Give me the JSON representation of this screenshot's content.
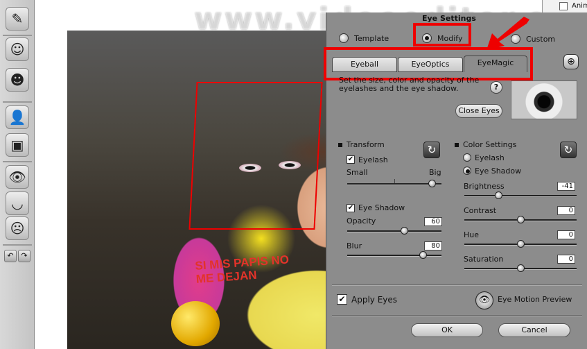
{
  "topright_label": "Anim",
  "watermark": "www.videoeditor.org",
  "toolbar": {
    "icons": [
      "paint-brush-icon",
      "face-select-icon",
      "face-adjust-icon",
      "portrait-edit-icon",
      "portrait-icon",
      "eye-icon",
      "mouth-icon",
      "head-icon"
    ],
    "undo": "↶",
    "redo": "↷"
  },
  "panel": {
    "title": "Eye Settings",
    "mode_radios": [
      {
        "label": "Template"
      },
      {
        "label": "Modify"
      },
      {
        "label": "Custom"
      }
    ],
    "tabs": [
      "Eyeball",
      "EyeOptics",
      "EyeMagic"
    ],
    "description": "Set the size, color and opacity of the eyelashes and the eye shadow.",
    "close_eyes": "Close Eyes",
    "help": "?",
    "transform": {
      "title": "Transform",
      "eyelash": "Eyelash",
      "small": "Small",
      "big": "Big",
      "eyeshadow": "Eye Shadow",
      "opacity": "Opacity",
      "opacity_val": "60",
      "blur": "Blur",
      "blur_val": "80",
      "size_level": 0.9
    },
    "color": {
      "title": "Color Settings",
      "eyelash": "Eyelash",
      "eyeshadow": "Eye Shadow",
      "brightness": "Brightness",
      "brightness_val": "-41",
      "contrast": "Contrast",
      "contrast_val": "0",
      "hue": "Hue",
      "hue_val": "0",
      "saturation": "Saturation",
      "saturation_val": "0"
    },
    "apply_eyes": "Apply Eyes",
    "eye_motion": "Eye Motion Preview",
    "ok": "OK",
    "cancel": "Cancel"
  },
  "photo_text": "SI MIS PAPIS NO ME DEJAN"
}
